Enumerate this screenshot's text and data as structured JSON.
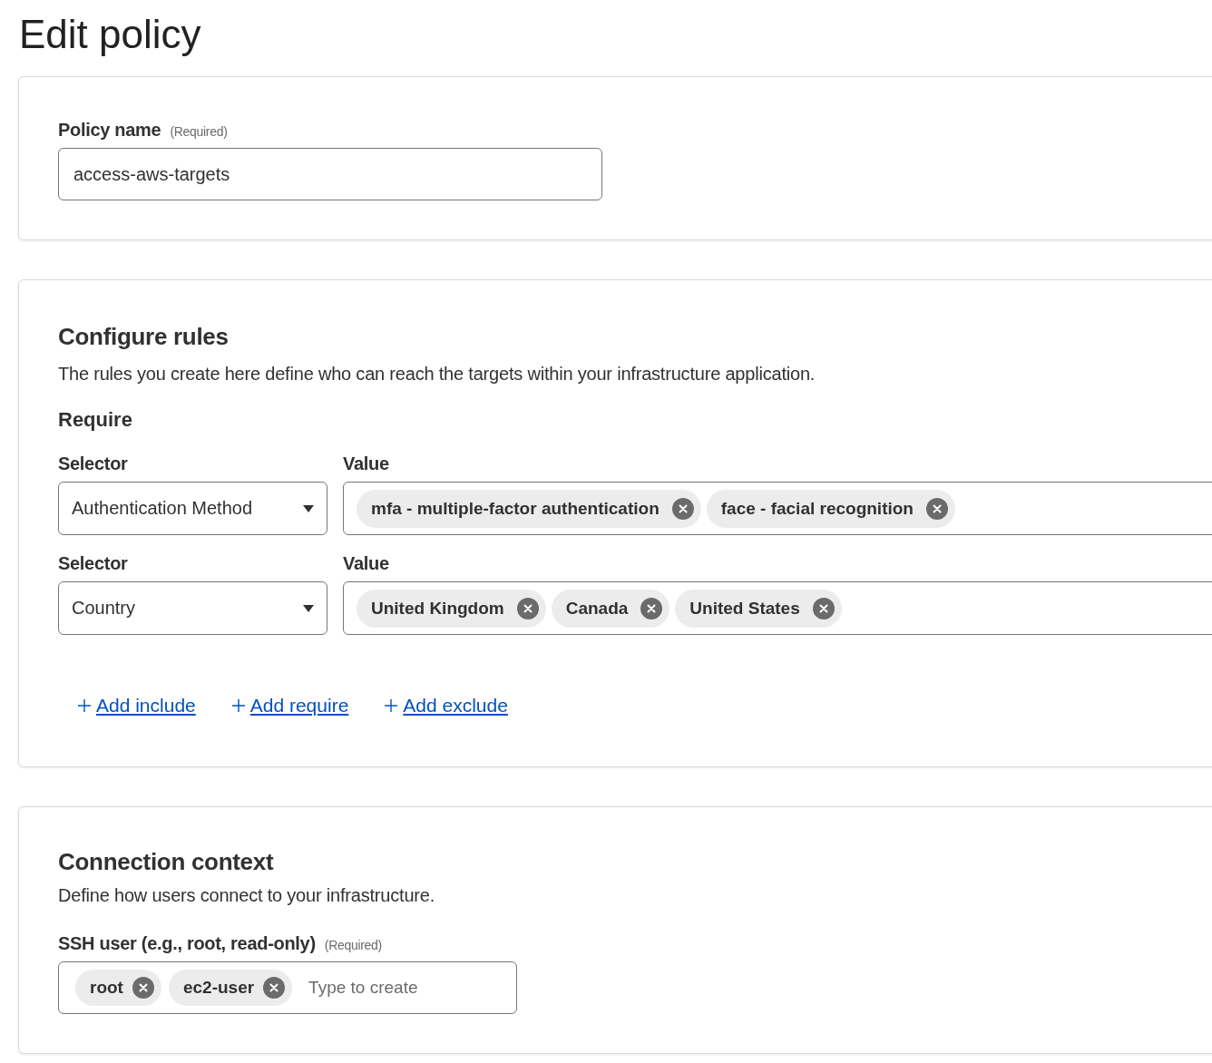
{
  "title": "Edit policy",
  "policy_name": {
    "label": "Policy name",
    "required": "(Required)",
    "value": "access-aws-targets"
  },
  "rules": {
    "title": "Configure rules",
    "description": "The rules you create here define who can reach the targets within your infrastructure application.",
    "section": "Require",
    "rows": [
      {
        "selector_label": "Selector",
        "value_label": "Value",
        "selector": "Authentication Method",
        "values": [
          "mfa - multiple-factor authentication",
          "face - facial recognition"
        ]
      },
      {
        "selector_label": "Selector",
        "value_label": "Value",
        "selector": "Country",
        "values": [
          "United Kingdom",
          "Canada",
          "United States"
        ]
      }
    ],
    "links": [
      "Add include",
      "Add require",
      "Add exclude"
    ]
  },
  "connection": {
    "title": "Connection context",
    "description": "Define how users connect to your infrastructure.",
    "ssh_label": "SSH user (e.g., root, read-only)",
    "required": "(Required)",
    "users": [
      "root",
      "ec2-user"
    ],
    "placeholder": "Type to create"
  }
}
